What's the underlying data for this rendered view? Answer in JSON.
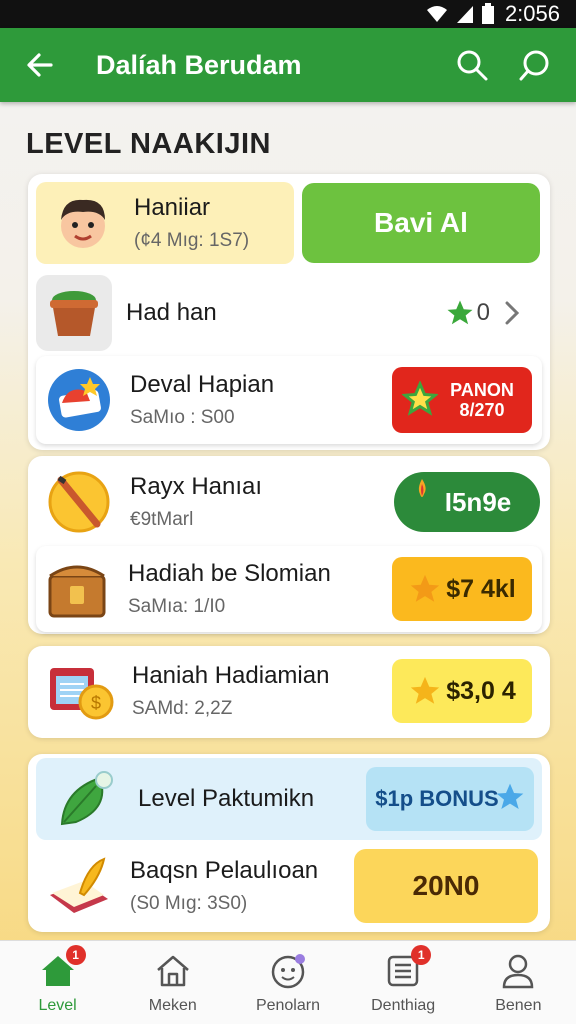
{
  "status_bar": {
    "time": "2:056"
  },
  "app_bar": {
    "title": "Dalíah Berudam"
  },
  "section_title": "LEVEL NAAKIJIN",
  "items": [
    {
      "name": "Haniiar",
      "sub": "(¢4 Mıg: 1S7)",
      "action": "Bavi Al"
    },
    {
      "name": "Had han",
      "value": "0"
    },
    {
      "name": "Deval Hapian",
      "sub": "SaMıo : S00",
      "action_top": "PANON",
      "action_bottom": "8/270"
    },
    {
      "name": "Rayx Hanıaı",
      "sub": "€9tMarl",
      "action": "I5n9e"
    },
    {
      "name": "Hadiah be Slomian",
      "sub": "SaMıa: 1/I0",
      "action": "$7 4kl"
    },
    {
      "name": "Haniah Hadiamian",
      "sub": "SAMd: 2,2Z",
      "action": "$3,0 4"
    },
    {
      "name": "Level Paktumikn",
      "action": "$1p BONUS"
    },
    {
      "name": "Baqsn Pelaulıoan",
      "sub": "(S0 Mıg: 3S0)",
      "action": "20N0"
    }
  ],
  "nav": [
    {
      "label": "Level",
      "badge": "1"
    },
    {
      "label": "Meken"
    },
    {
      "label": "Penolarn"
    },
    {
      "label": "Denthiag",
      "badge": "1"
    },
    {
      "label": "Benen"
    }
  ],
  "colors": {
    "primary": "#2e9a3a",
    "accent_yellow": "#fbc531",
    "red": "#e0302a"
  }
}
